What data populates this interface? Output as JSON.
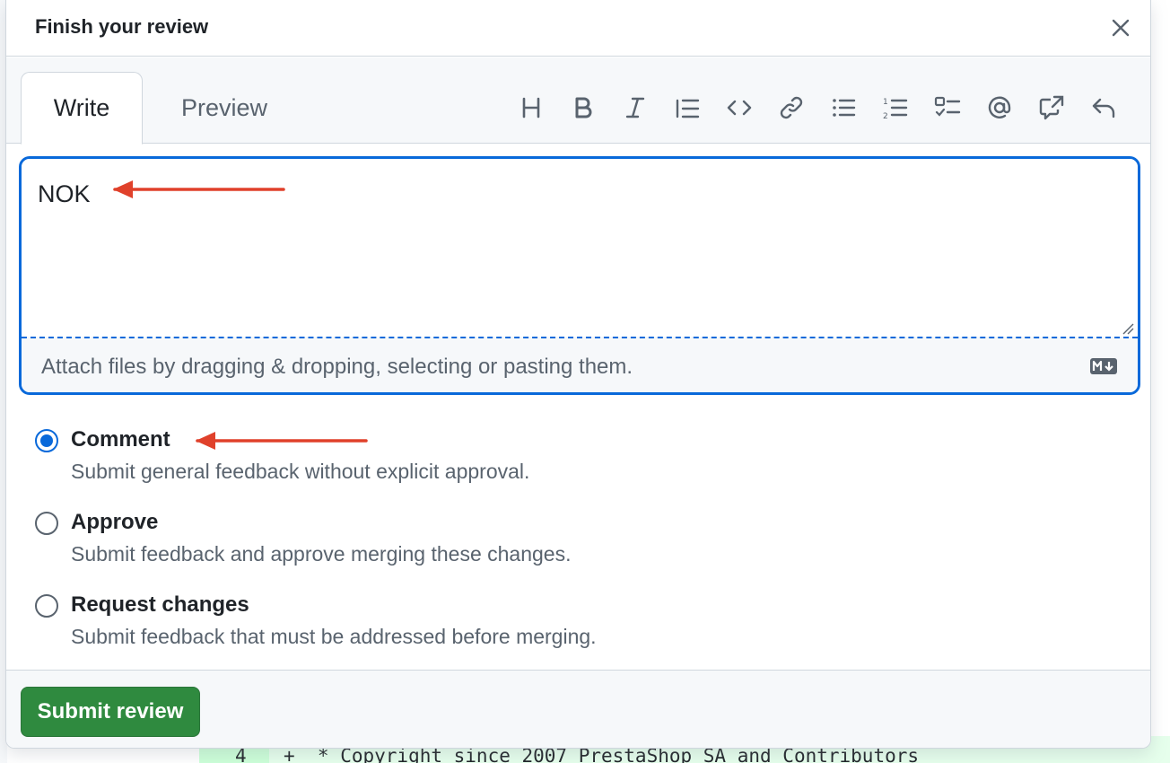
{
  "dialog": {
    "title": "Finish your review",
    "close_icon": "close-icon"
  },
  "tabs": {
    "write": "Write",
    "preview": "Preview"
  },
  "toolbar": {
    "icons": [
      "heading-icon",
      "bold-icon",
      "italic-icon",
      "quote-icon",
      "code-icon",
      "link-icon",
      "unordered-list-icon",
      "ordered-list-icon",
      "task-list-icon",
      "mention-icon",
      "cross-reference-icon",
      "reply-icon"
    ]
  },
  "editor": {
    "value": "NOK",
    "attach_text": "Attach files by dragging & dropping, selecting or pasting them.",
    "markdown_icon": "markdown-icon"
  },
  "options": [
    {
      "label": "Comment",
      "description": "Submit general feedback without explicit approval.",
      "checked": true
    },
    {
      "label": "Approve",
      "description": "Submit feedback and approve merging these changes.",
      "checked": false
    },
    {
      "label": "Request changes",
      "description": "Submit feedback that must be addressed before merging.",
      "checked": false
    }
  ],
  "footer": {
    "submit_label": "Submit review"
  },
  "background": {
    "line_number": "4",
    "code_line": "+  * Copyright since 2007 PrestaShop SA and Contributors"
  },
  "colors": {
    "accent": "#0969da",
    "submit": "#2f8a3f",
    "annotation_arrow": "#e0412b"
  }
}
